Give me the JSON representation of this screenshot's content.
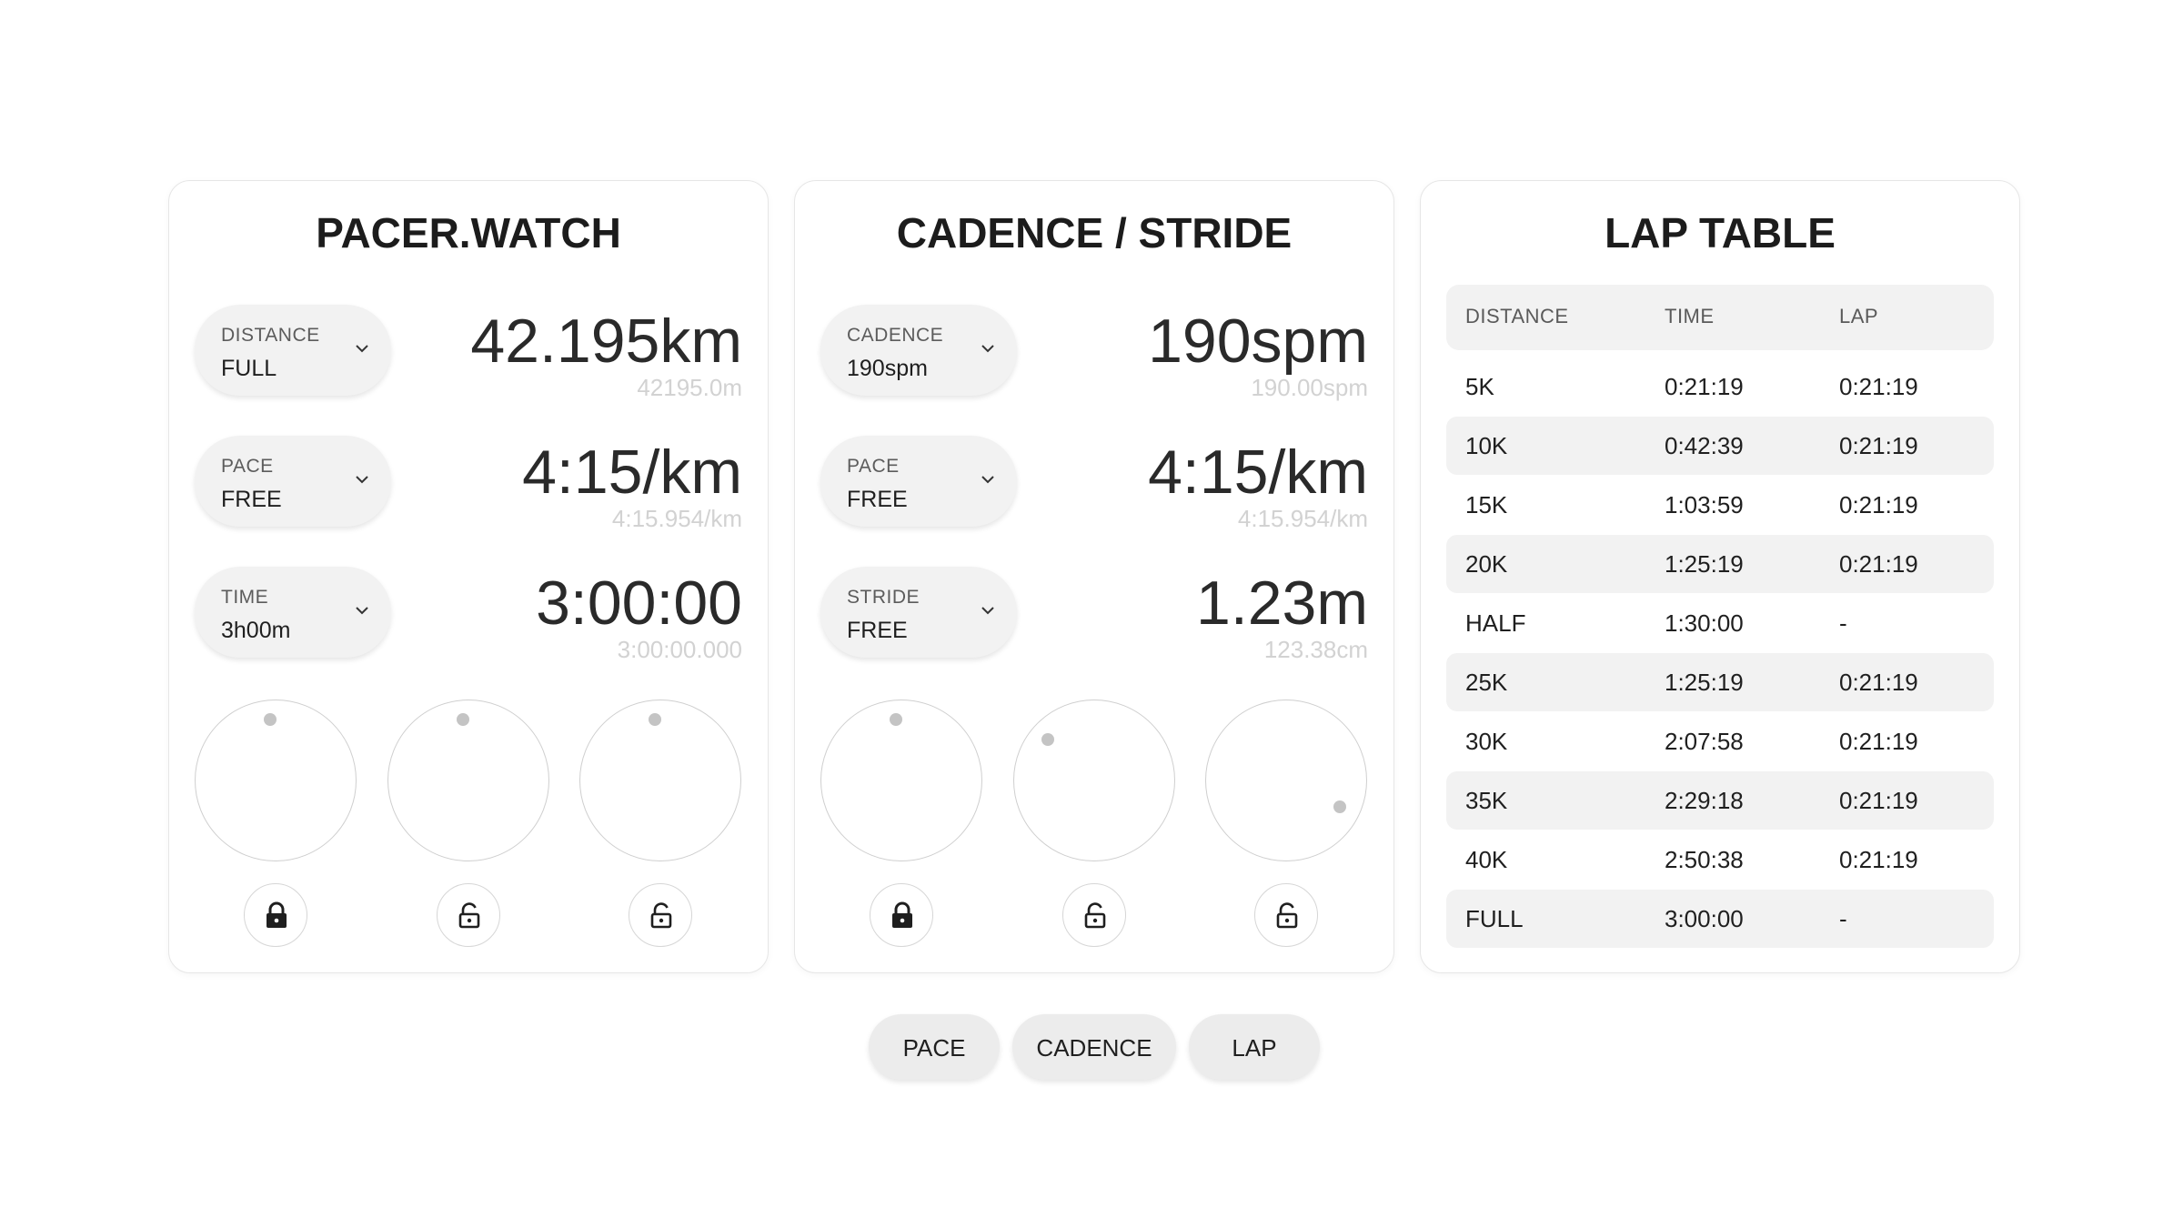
{
  "pace_card": {
    "title": "PACER.WATCH",
    "rows": [
      {
        "label": "DISTANCE",
        "value": "FULL",
        "big": "42.195km",
        "sub": "42195.0m"
      },
      {
        "label": "PACE",
        "value": "FREE",
        "big": "4:15/km",
        "sub": "4:15.954/km"
      },
      {
        "label": "TIME",
        "value": "3h00m",
        "big": "3:00:00",
        "sub": "3:00:00.000"
      }
    ],
    "locks": [
      "locked",
      "unlocked",
      "unlocked"
    ]
  },
  "cadence_card": {
    "title": "CADENCE / STRIDE",
    "rows": [
      {
        "label": "CADENCE",
        "value": "190spm",
        "big": "190spm",
        "sub": "190.00spm"
      },
      {
        "label": "PACE",
        "value": "FREE",
        "big": "4:15/km",
        "sub": "4:15.954/km"
      },
      {
        "label": "STRIDE",
        "value": "FREE",
        "big": "1.23m",
        "sub": "123.38cm"
      }
    ],
    "locks": [
      "locked",
      "unlocked",
      "unlocked"
    ]
  },
  "lap_card": {
    "title": "LAP TABLE",
    "headers": [
      "DISTANCE",
      "TIME",
      "LAP"
    ],
    "rows": [
      [
        "5K",
        "0:21:19",
        "0:21:19"
      ],
      [
        "10K",
        "0:42:39",
        "0:21:19"
      ],
      [
        "15K",
        "1:03:59",
        "0:21:19"
      ],
      [
        "20K",
        "1:25:19",
        "0:21:19"
      ],
      [
        "HALF",
        "1:30:00",
        "-"
      ],
      [
        "25K",
        "1:25:19",
        "0:21:19"
      ],
      [
        "30K",
        "2:07:58",
        "0:21:19"
      ],
      [
        "35K",
        "2:29:18",
        "0:21:19"
      ],
      [
        "40K",
        "2:50:38",
        "0:21:19"
      ],
      [
        "FULL",
        "3:00:00",
        "-"
      ]
    ]
  },
  "tabs": [
    "PACE",
    "CADENCE",
    "LAP"
  ],
  "icons": {
    "dropdown": "chevron-down-icon",
    "lock": "lock-icon",
    "unlock": "unlock-icon"
  },
  "colors": {
    "background": "#ffffff",
    "card_border": "#e6e6e6",
    "pill": "#f2f2f2",
    "muted_text": "#d2d2d2",
    "dial_dot": "#c4c4c4"
  }
}
